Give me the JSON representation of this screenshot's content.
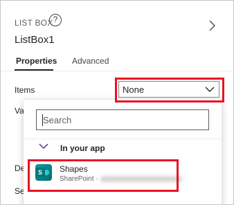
{
  "panel": {
    "control_type": "LIST BOX",
    "control_name": "ListBox1",
    "help_icon": "help-circle-icon",
    "expand_icon": "chevron-right-icon"
  },
  "tabs": [
    {
      "label": "Properties",
      "active": true
    },
    {
      "label": "Advanced",
      "active": false
    }
  ],
  "properties": {
    "items_label": "Items",
    "items_value": "None",
    "value_label_partial": "Va",
    "default_label_partial": "De",
    "selection_label_partial": "Se"
  },
  "dropdown": {
    "search_placeholder": "Search",
    "section_label": "In your app",
    "items": [
      {
        "name": "Shapes",
        "source": "SharePoint",
        "icon": "sharepoint-icon",
        "detail_redacted": true
      }
    ]
  },
  "colors": {
    "highlight": "#e81123",
    "sharepoint": "#036c70"
  }
}
